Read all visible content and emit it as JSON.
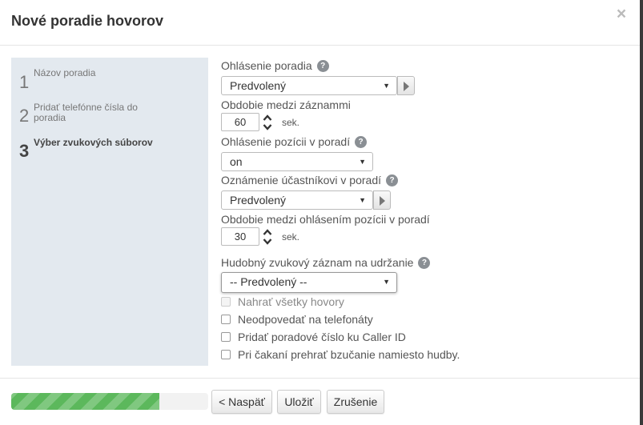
{
  "dialog": {
    "title": "Nové poradie hovorov",
    "close_glyph": "×"
  },
  "steps": [
    {
      "number": "1",
      "label": "Názov poradia",
      "active": false
    },
    {
      "number": "2",
      "label": "Pridať telefónne čísla do poradia",
      "active": false
    },
    {
      "number": "3",
      "label": "Výber zvukových súborov",
      "active": true
    }
  ],
  "form": {
    "queue_announcement": {
      "label": "Ohlásenie poradia",
      "value": "Predvolený",
      "help": "?"
    },
    "period_between_recordings": {
      "label": "Obdobie medzi záznammi",
      "value": "60",
      "unit": "sek."
    },
    "position_announcement": {
      "label": "Ohlásenie pozícii v poradí",
      "value": "on",
      "help": "?"
    },
    "participant_notice": {
      "label": "Oznámenie účastníkovi v poradí",
      "value": "Predvolený",
      "help": "?"
    },
    "period_between_position": {
      "label": "Obdobie medzi ohlásením pozícii v poradí",
      "value": "30",
      "unit": "sek."
    },
    "hold_music": {
      "label": "Hudobný zvukový záznam na udržanie",
      "value": "-- Predvolený --",
      "help": "?"
    }
  },
  "checkboxes": [
    {
      "label": "Nahrať všetky hovory",
      "checked": false,
      "disabled": true
    },
    {
      "label": "Neodpovedať na telefonáty",
      "checked": false,
      "disabled": false
    },
    {
      "label": "Pridať poradové číslo ku Caller ID",
      "checked": false,
      "disabled": false
    },
    {
      "label": "Pri čakaní prehrať bzučanie namiesto hudby.",
      "checked": false,
      "disabled": false
    }
  ],
  "footer": {
    "progress": 0.75,
    "progress_color": "#5cb85c",
    "back_label": "< Naspäť",
    "save_label": "Uložiť",
    "cancel_label": "Zrušenie"
  }
}
